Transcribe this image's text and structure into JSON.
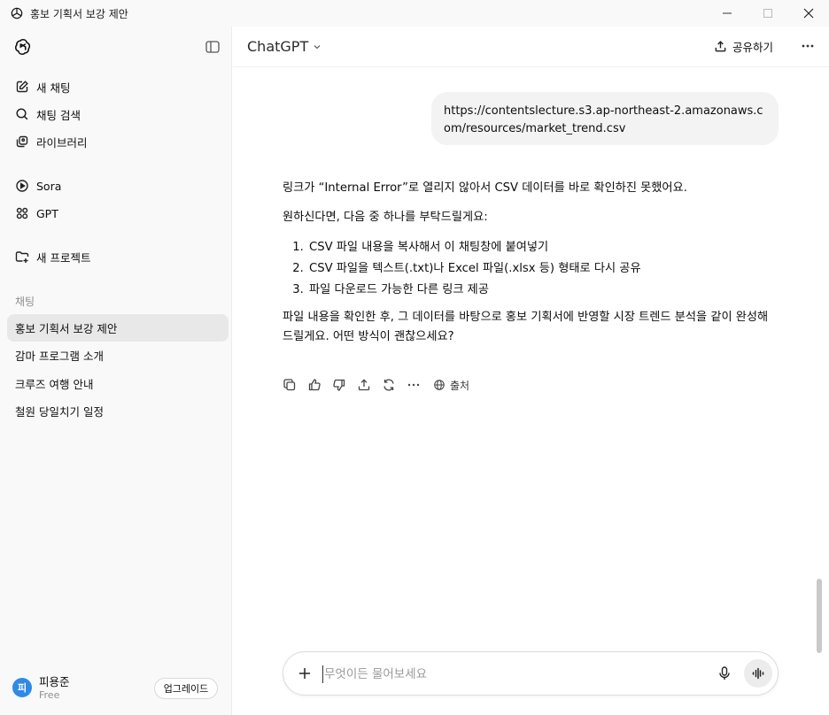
{
  "window": {
    "title": "홍보 기획서 보강 제안"
  },
  "sidebar": {
    "nav": [
      {
        "label": "새 채팅",
        "icon": "edit-icon"
      },
      {
        "label": "채팅 검색",
        "icon": "search-icon"
      },
      {
        "label": "라이브러리",
        "icon": "library-icon"
      },
      {
        "label": "Sora",
        "icon": "play-circle-icon"
      },
      {
        "label": "GPT",
        "icon": "grid-icon"
      },
      {
        "label": "새 프로젝트",
        "icon": "folder-plus-icon"
      }
    ],
    "section_label": "채팅",
    "chats": [
      {
        "label": "홍보 기획서 보강 제안",
        "active": true
      },
      {
        "label": "감마 프로그램 소개",
        "active": false
      },
      {
        "label": "크루즈 여행 안내",
        "active": false
      },
      {
        "label": "철원 당일치기 일정",
        "active": false
      }
    ],
    "user": {
      "avatar": "피",
      "name": "피용준",
      "plan": "Free",
      "upgrade_label": "업그레이드"
    }
  },
  "header": {
    "model": "ChatGPT",
    "share_label": "공유하기"
  },
  "conversation": {
    "user_message": "https://contentslecture.s3.ap-northeast-2.amazonaws.com/resources/market_trend.csv",
    "assistant": {
      "p1": "링크가 “Internal Error”로 열리지 않아서 CSV 데이터를 바로 확인하진 못했어요.",
      "p2": "원하신다면, 다음 중 하나를 부탁드릴게요:",
      "list": [
        "CSV 파일 내용을 복사해서 이 채팅창에 붙여넣기",
        "CSV 파일을 텍스트(.txt)나 Excel 파일(.xlsx 등) 형태로 다시 공유",
        "파일 다운로드 가능한 다른 링크 제공"
      ],
      "p3": "파일 내용을 확인한 후, 그 데이터를 바탕으로 홍보 기획서에 반영할 시장 트렌드 분석을 같이 완성해 드릴게요. 어떤 방식이 괜찮으세요?"
    },
    "sources_label": "출처"
  },
  "composer": {
    "placeholder": "무엇이든 물어보세요"
  },
  "colors": {
    "sidebar_bg": "#f9f9f9",
    "active_chat_bg": "#e8e8e8",
    "avatar_bg": "#2f8ae5",
    "bubble_bg": "#f3f3f3"
  }
}
